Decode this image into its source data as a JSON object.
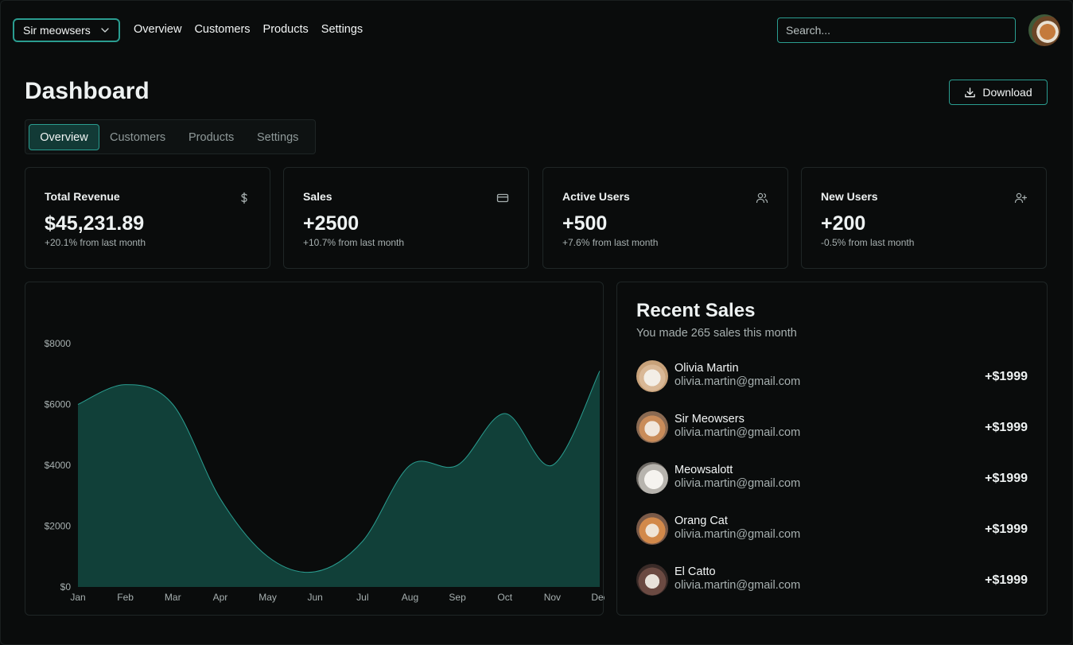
{
  "topnav": {
    "team_selector": "Sir meowsers",
    "links": [
      "Overview",
      "Customers",
      "Products",
      "Settings"
    ],
    "search_placeholder": "Search..."
  },
  "header": {
    "title": "Dashboard",
    "download_label": "Download"
  },
  "tabs": [
    "Overview",
    "Customers",
    "Products",
    "Settings"
  ],
  "active_tab": "Overview",
  "stats": [
    {
      "label": "Total Revenue",
      "value": "$45,231.89",
      "delta": "+20.1% from last month",
      "icon": "dollar-icon"
    },
    {
      "label": "Sales",
      "value": "+2500",
      "delta": "+10.7% from last month",
      "icon": "credit-card-icon"
    },
    {
      "label": "Active Users",
      "value": "+500",
      "delta": "+7.6% from last month",
      "icon": "users-icon"
    },
    {
      "label": "New Users",
      "value": "+200",
      "delta": "-0.5% from last month",
      "icon": "user-plus-icon"
    }
  ],
  "recent_sales": {
    "title": "Recent Sales",
    "subtitle": "You made 265 sales this month",
    "items": [
      {
        "name": "Olivia Martin",
        "email": "olivia.martin@gmail.com",
        "amount": "+$1999"
      },
      {
        "name": "Sir Meowsers",
        "email": "olivia.martin@gmail.com",
        "amount": "+$1999"
      },
      {
        "name": "Meowsalott",
        "email": "olivia.martin@gmail.com",
        "amount": "+$1999"
      },
      {
        "name": "Orang Cat",
        "email": "olivia.martin@gmail.com",
        "amount": "+$1999"
      },
      {
        "name": "El Catto",
        "email": "olivia.martin@gmail.com",
        "amount": "+$1999"
      }
    ]
  },
  "colors": {
    "accent": "#2a9d90",
    "area_fill": "#114039",
    "background": "#0a0c0c"
  },
  "chart_data": {
    "type": "area",
    "x": [
      "Jan",
      "Feb",
      "Mar",
      "Apr",
      "May",
      "Jun",
      "Jul",
      "Aug",
      "Sep",
      "Oct",
      "Nov",
      "Dec"
    ],
    "values": [
      6000,
      6650,
      6000,
      2900,
      1000,
      500,
      1500,
      4000,
      4000,
      5700,
      4000,
      7100
    ],
    "y_ticks": [
      "$0",
      "$2000",
      "$4000",
      "$6000",
      "$8000"
    ],
    "ylim": [
      0,
      8000
    ],
    "grid": false
  }
}
